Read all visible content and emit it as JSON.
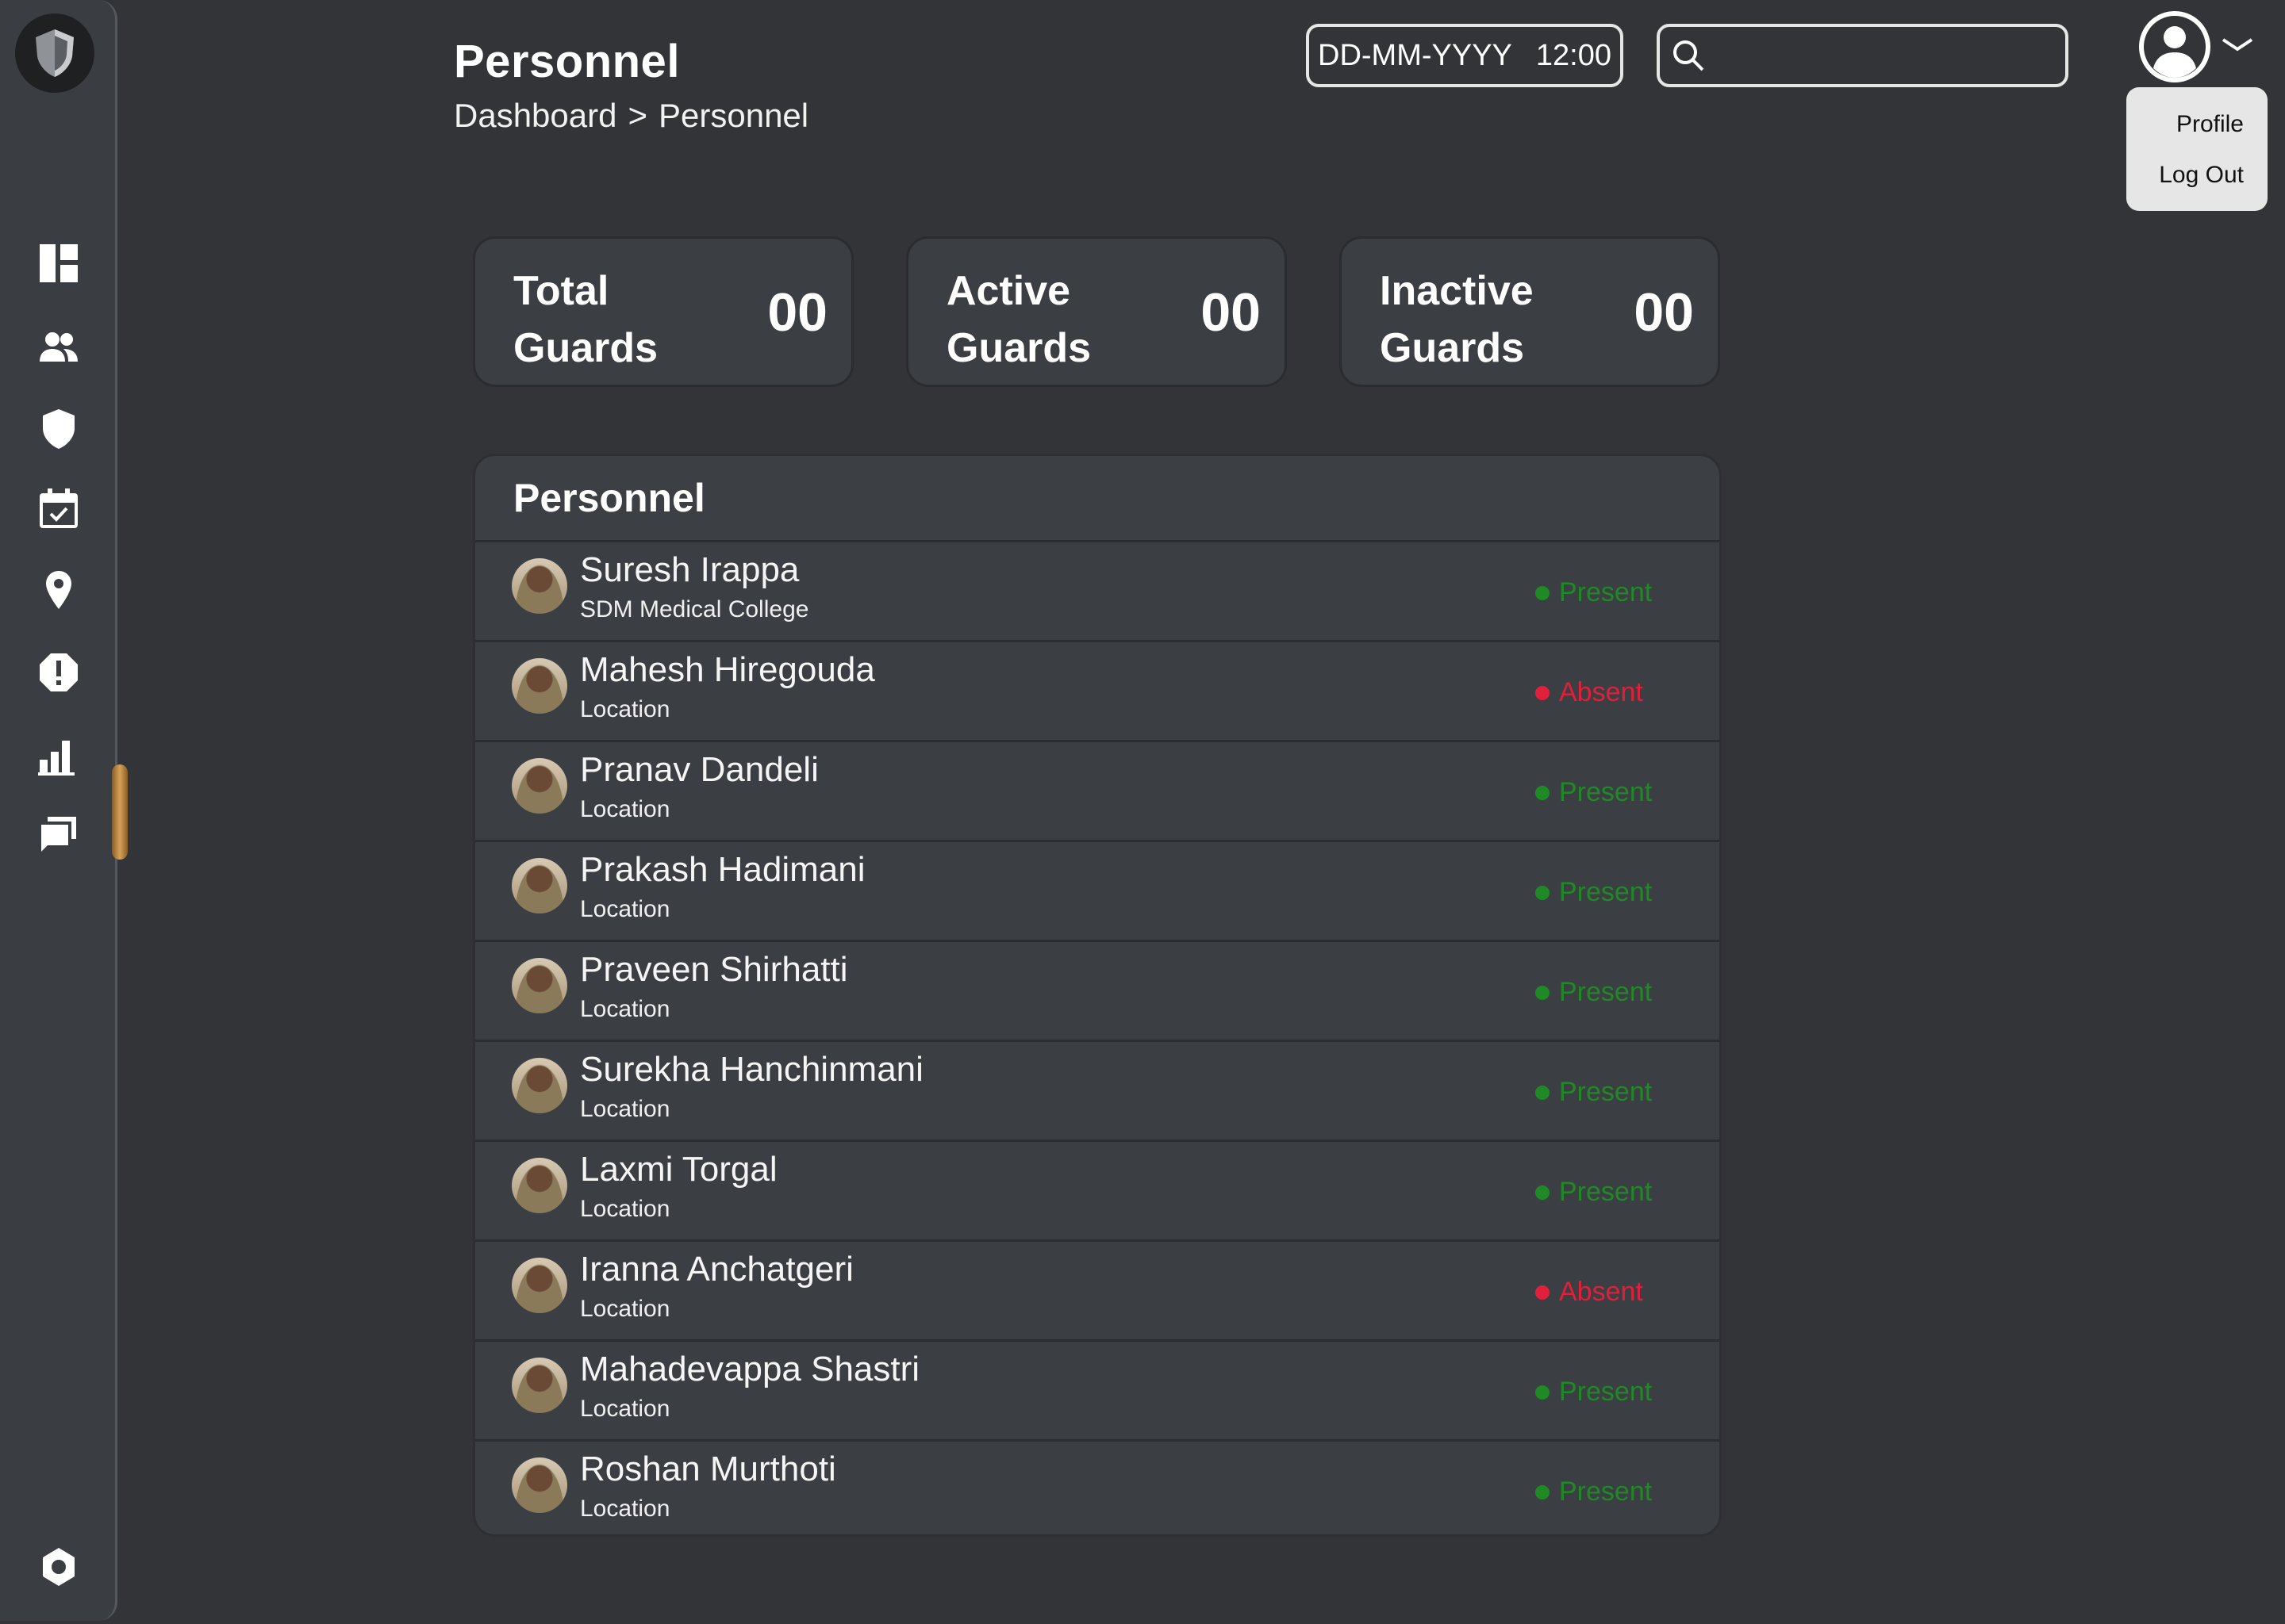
{
  "header": {
    "title": "Personnel",
    "breadcrumb": [
      "Dashboard",
      ">",
      "Personnel"
    ],
    "date": "DD-MM-YYYY",
    "time": "12:00",
    "search_placeholder": ""
  },
  "user_menu": {
    "items": [
      "Profile",
      "Log Out"
    ]
  },
  "sidebar": {
    "icons": [
      "dashboard-icon",
      "people-icon",
      "shield-icon",
      "calendar-check-icon",
      "location-pin-icon",
      "alert-icon",
      "bar-chart-icon",
      "chat-icon",
      "settings-icon"
    ]
  },
  "stats": [
    {
      "label": "Total Guards",
      "value": "00"
    },
    {
      "label": "Active Guards",
      "value": "00"
    },
    {
      "label": "Inactive Guards",
      "value": "00"
    }
  ],
  "panel": {
    "title": "Personnel",
    "rows": [
      {
        "name": "Suresh Irappa",
        "location": "SDM Medical College",
        "status": "Present"
      },
      {
        "name": "Mahesh Hiregouda",
        "location": "Location",
        "status": "Absent"
      },
      {
        "name": "Pranav Dandeli",
        "location": "Location",
        "status": "Present"
      },
      {
        "name": "Prakash Hadimani",
        "location": "Location",
        "status": "Present"
      },
      {
        "name": "Praveen Shirhatti",
        "location": "Location",
        "status": "Present"
      },
      {
        "name": "Surekha Hanchinmani",
        "location": "Location",
        "status": "Present"
      },
      {
        "name": "Laxmi Torgal",
        "location": "Location",
        "status": "Present"
      },
      {
        "name": "Iranna Anchatgeri",
        "location": "Location",
        "status": "Absent"
      },
      {
        "name": "Mahadevappa Shastri",
        "location": "Location",
        "status": "Present"
      },
      {
        "name": "Roshan Murthoti",
        "location": "Location",
        "status": "Present"
      }
    ]
  },
  "colors": {
    "present": "#1f8a25",
    "absent": "#e0203a",
    "accent": "#c8954a",
    "background": "#323437"
  }
}
